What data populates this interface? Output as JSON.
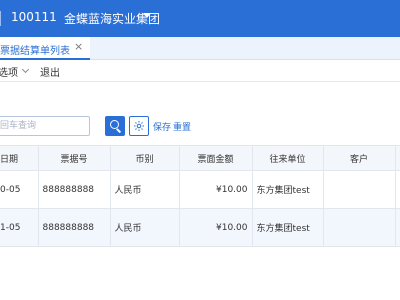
{
  "header": {
    "org_code": "100111",
    "org_name": "金蝶蓝海实业集团",
    "brand_color": "#2a6fd6"
  },
  "tabs": [
    {
      "label": "收票据结算单列表",
      "active": true,
      "close_icon": "×"
    }
  ],
  "menubar": {
    "options_label": "选项",
    "exit_label": "退出"
  },
  "search": {
    "value": "",
    "placeholder": "按回车查询",
    "save_label": "保存",
    "reset_label": "重置"
  },
  "grid": {
    "columns": [
      "日期",
      "票据号",
      "币别",
      "票面金额",
      "往来单位",
      "客户"
    ],
    "rows": [
      {
        "date": "0-05",
        "bill_no": "888888888",
        "currency": "人民币",
        "amount": "¥10.00",
        "partner": "东方集团test",
        "customer": ""
      },
      {
        "date": "1-05",
        "bill_no": "888888888",
        "currency": "人民币",
        "amount": "¥10.00",
        "partner": "东方集团test",
        "customer": ""
      }
    ]
  }
}
